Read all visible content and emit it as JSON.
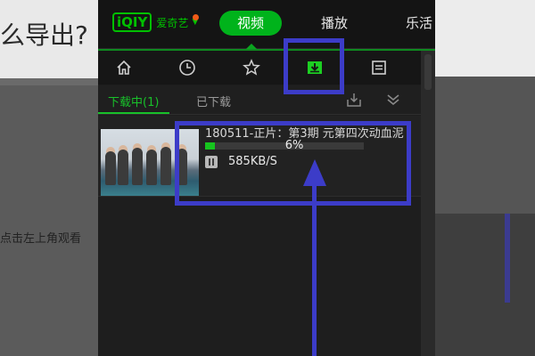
{
  "background": {
    "title_fragment": "么导出?",
    "hint_fragment": "点击左上角观看"
  },
  "app": {
    "logo_mark": "iQIY",
    "logo_text": "爱奇艺",
    "nav": {
      "video": "视频",
      "play": "播放",
      "lehuo": "乐活"
    },
    "icon_row": [
      "home-icon",
      "history-icon",
      "favorites-icon",
      "download-icon",
      "list-icon"
    ],
    "subtabs": {
      "downloading": "下载中(1)",
      "downloaded": "已下载"
    },
    "item": {
      "title": "180511-正片：第3期 元第四次动血泥",
      "progress_percent": 6,
      "percent_label": "6%",
      "speed": "585KB/S"
    }
  },
  "colors": {
    "accent_green": "#00b31b",
    "annotation_blue": "#3c3cc8",
    "notification_orange": "#f25b18"
  }
}
